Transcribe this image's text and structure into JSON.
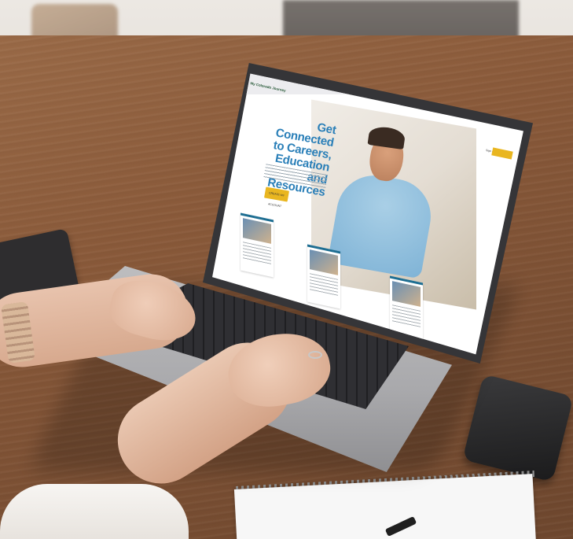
{
  "website": {
    "logo_text": "My Colorado Journey",
    "hero_title": "Get Connected to Careers, Education and Resources",
    "cta_button": "CREATE MY ACCOUNT",
    "header_signin": "Sign In",
    "colors": {
      "title_blue": "#2a7fb8",
      "button_yellow": "#e9b620",
      "card_teal": "#1e6e92"
    }
  },
  "objects": {
    "icons": [
      "laptop-icon",
      "phone-icon",
      "tablet-icon",
      "notebook-icon"
    ]
  }
}
